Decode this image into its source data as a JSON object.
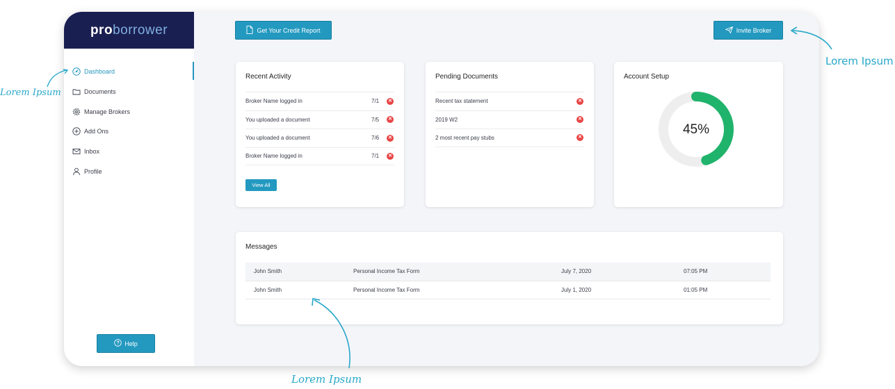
{
  "brand": {
    "pro": "pro",
    "borrower": "borrower"
  },
  "sidebar": {
    "items": [
      {
        "label": "Dashboard",
        "icon": "dashboard-icon",
        "active": true
      },
      {
        "label": "Documents",
        "icon": "folder-icon"
      },
      {
        "label": "Manage Brokers",
        "icon": "gear-icon"
      },
      {
        "label": "Add Ons",
        "icon": "plus-circle-icon"
      },
      {
        "label": "Inbox",
        "icon": "mail-icon"
      },
      {
        "label": "Profile",
        "icon": "user-icon"
      }
    ],
    "help_label": "Help"
  },
  "toolbar": {
    "credit_report_label": "Get Your Credit Report",
    "invite_broker_label": "Invite Broker"
  },
  "recent_activity": {
    "title": "Recent Activity",
    "rows": [
      {
        "text": "Broker Name logged in",
        "date": "7/1"
      },
      {
        "text": "You uploaded a document",
        "date": "7/5"
      },
      {
        "text": "You uploaded a document",
        "date": "7/6"
      },
      {
        "text": "Broker Name logged in",
        "date": "7/1"
      }
    ],
    "view_all_label": "View All"
  },
  "pending_documents": {
    "title": "Pending Documents",
    "rows": [
      {
        "text": "Recent tax statement"
      },
      {
        "text": "2019 W2"
      },
      {
        "text": "2 most recent pay stubs"
      }
    ]
  },
  "account_setup": {
    "title": "Account Setup",
    "progress_percent": 45,
    "progress_label": "45%",
    "ring_color": "#1fb36b",
    "track_color": "#eeeeee"
  },
  "messages": {
    "title": "Messages",
    "rows": [
      {
        "name": "John Smith",
        "subject": "Personal Income Tax Form",
        "date": "July 7, 2020",
        "time": "07:05 PM"
      },
      {
        "name": "John Smith",
        "subject": "Personal Income Tax Form",
        "date": "July 1, 2020",
        "time": "01:05 PM"
      }
    ]
  },
  "annotations": {
    "left": "Lorem Ipsum",
    "right": "Lorem Ipsum",
    "bottom": "Lorem Ipsum"
  },
  "colors": {
    "accent": "#2399c0",
    "brand_bg": "#1a1f52",
    "danger": "#e84545"
  }
}
